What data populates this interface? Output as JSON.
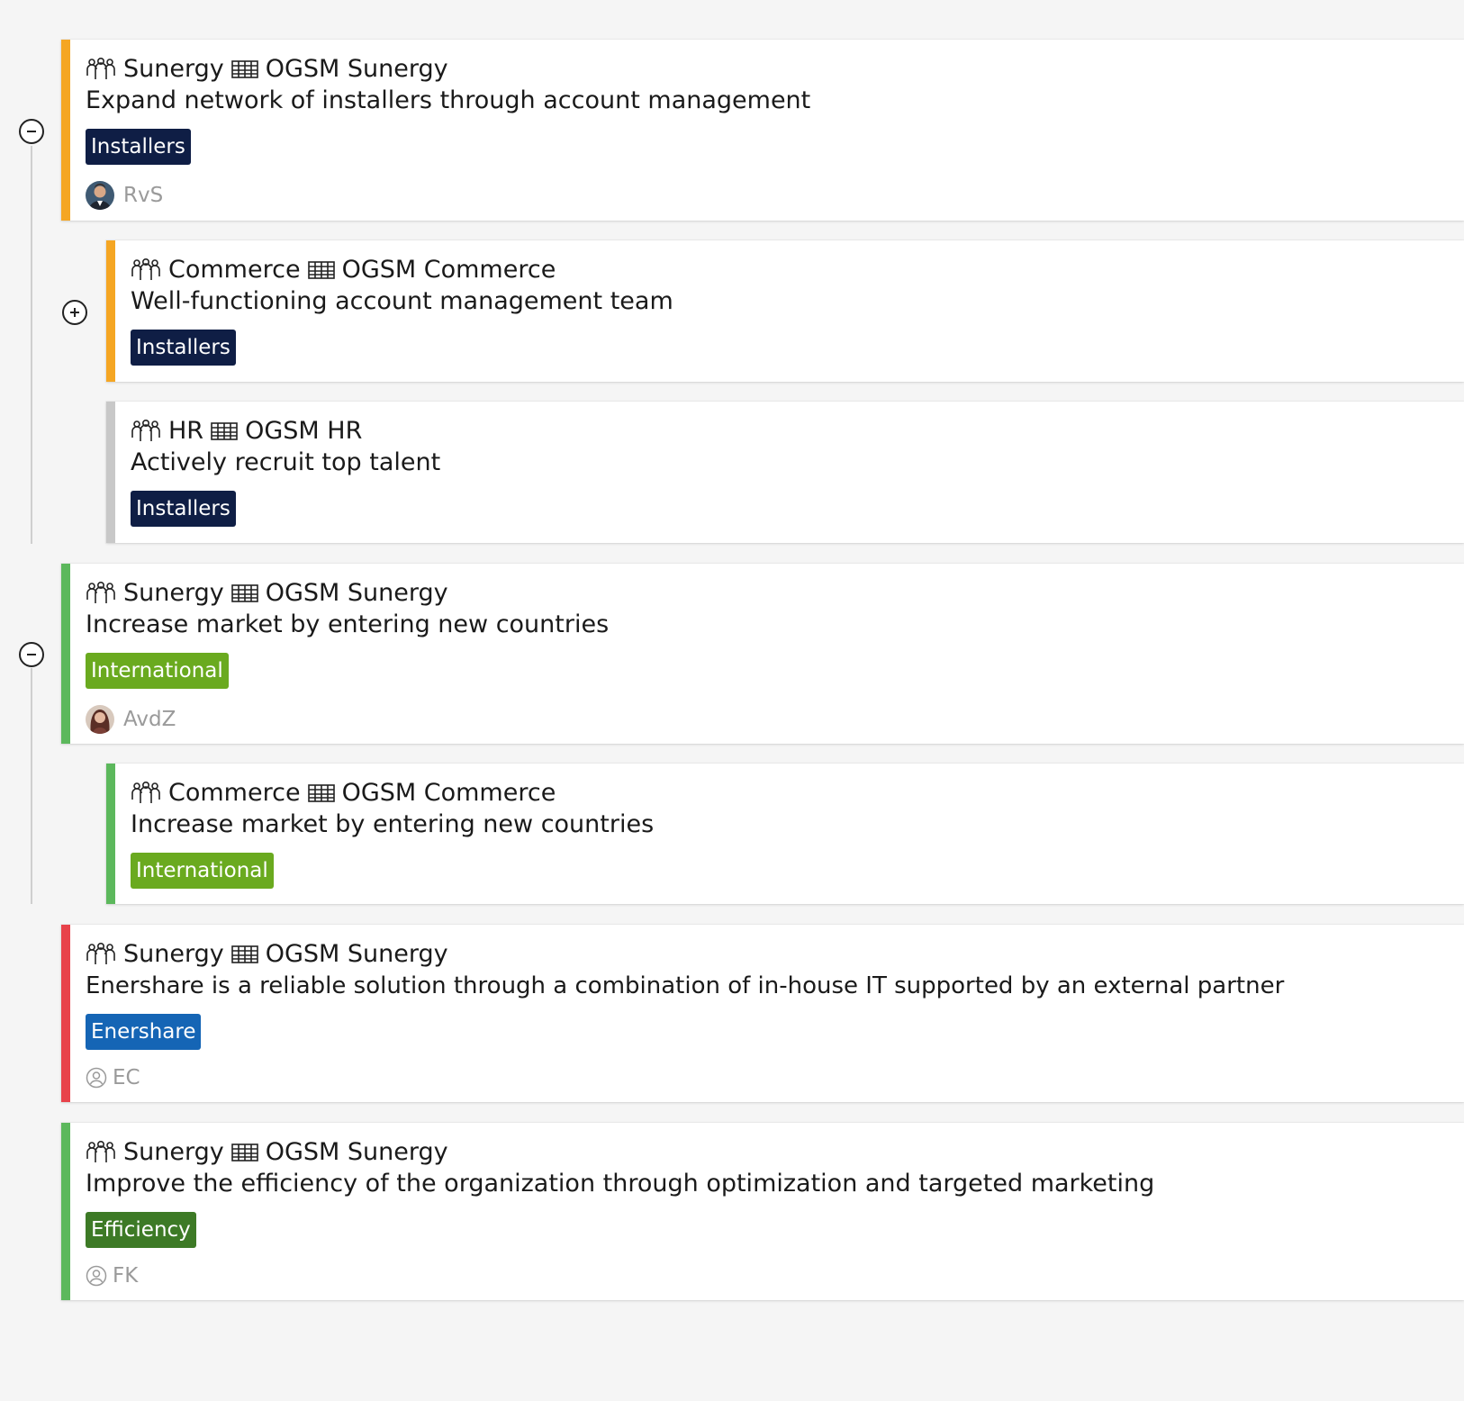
{
  "colors": {
    "orange": "#f5a623",
    "gray": "#c8c8c8",
    "green": "#5cb85c",
    "red": "#e8424a",
    "tag_navy": "#0f1e45",
    "tag_lime": "#6aaa1f",
    "tag_blue": "#1565b5",
    "tag_darkgreen": "#3d7a26"
  },
  "icons": {
    "team": "team-icon",
    "table": "table-icon",
    "user": "user-circle-icon"
  },
  "toggles": [
    "collapse",
    "expand",
    "collapse"
  ],
  "cards": [
    {
      "team": "Sunergy",
      "ogsm": "OGSM Sunergy",
      "title": "Expand network of installers through account management",
      "tag": "Installers",
      "owner": "RvS"
    },
    {
      "team": "Commerce",
      "ogsm": "OGSM Commerce",
      "title": "Well-functioning account management team",
      "tag": "Installers",
      "owner": ""
    },
    {
      "team": "HR",
      "ogsm": "OGSM HR",
      "title": "Actively recruit top talent",
      "tag": "Installers",
      "owner": ""
    },
    {
      "team": "Sunergy",
      "ogsm": "OGSM Sunergy",
      "title": "Increase market by entering new countries",
      "tag": "International",
      "owner": "AvdZ"
    },
    {
      "team": "Commerce",
      "ogsm": "OGSM Commerce",
      "title": "Increase market by entering new countries",
      "tag": "International",
      "owner": ""
    },
    {
      "team": "Sunergy",
      "ogsm": "OGSM Sunergy",
      "title": "Enershare is a reliable solution through a combination of in-house IT supported by an external partner",
      "tag": "Enershare",
      "owner": "EC"
    },
    {
      "team": "Sunergy",
      "ogsm": "OGSM Sunergy",
      "title": "Improve the efficiency of the organization through optimization and targeted marketing",
      "tag": "Efficiency",
      "owner": "FK"
    }
  ]
}
